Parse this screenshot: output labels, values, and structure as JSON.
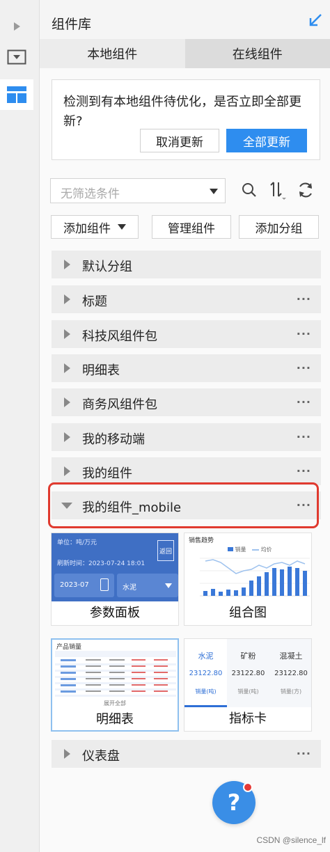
{
  "header": {
    "title": "组件库",
    "collapse_icon": "collapse-arrow-icon"
  },
  "tabs": [
    {
      "label": "本地组件",
      "active": true
    },
    {
      "label": "在线组件",
      "active": false
    }
  ],
  "notice": {
    "message": "检测到有本地组件待优化，是否立即全部更新?",
    "cancel_label": "取消更新",
    "update_label": "全部更新"
  },
  "filter": {
    "placeholder": "无筛选条件"
  },
  "actions": {
    "add_component": "添加组件",
    "manage": "管理组件",
    "add_group": "添加分组"
  },
  "groups": [
    {
      "label": "默认分组",
      "expanded": false,
      "has_more": false
    },
    {
      "label": "标题",
      "expanded": false,
      "has_more": true
    },
    {
      "label": "科技风组件包",
      "expanded": false,
      "has_more": true
    },
    {
      "label": "明细表",
      "expanded": false,
      "has_more": true
    },
    {
      "label": "商务风组件包",
      "expanded": false,
      "has_more": true
    },
    {
      "label": "我的移动端",
      "expanded": false,
      "has_more": true
    },
    {
      "label": "我的组件",
      "expanded": false,
      "has_more": true
    },
    {
      "label": "我的组件_mobile",
      "expanded": true,
      "has_more": true
    },
    {
      "label": "仪表盘",
      "expanded": false,
      "has_more": true
    }
  ],
  "more_glyph": "···",
  "cards": [
    {
      "caption": "参数面板"
    },
    {
      "caption": "组合图"
    },
    {
      "caption": "明细表"
    },
    {
      "caption": "指标卡"
    }
  ],
  "thumb_param": {
    "unit": "单位：吨/万元",
    "refresh": "刷新时间：2023-07-24 18:01",
    "return": "返回",
    "month": "2023-07",
    "select": "水泥"
  },
  "thumb_combo": {
    "title": "销售趋势",
    "legend_a": "销量",
    "legend_b": "均价"
  },
  "thumb_table": {
    "title": "产品销量",
    "pager": "展开全部"
  },
  "thumb_kpi": [
    {
      "name": "水泥",
      "value": "23122.80",
      "tag": "销量(吨)"
    },
    {
      "name": "矿粉",
      "value": "23122.80",
      "tag": "销量(吨)"
    },
    {
      "name": "混凝土",
      "value": "23122.80",
      "tag": "销量(方)"
    }
  ],
  "help": {
    "label": "?"
  },
  "watermark": "CSDN @silence_lf",
  "colors": {
    "accent": "#2e8def",
    "highlight": "#e03a2f",
    "param_bg": "#3f6fc4"
  }
}
